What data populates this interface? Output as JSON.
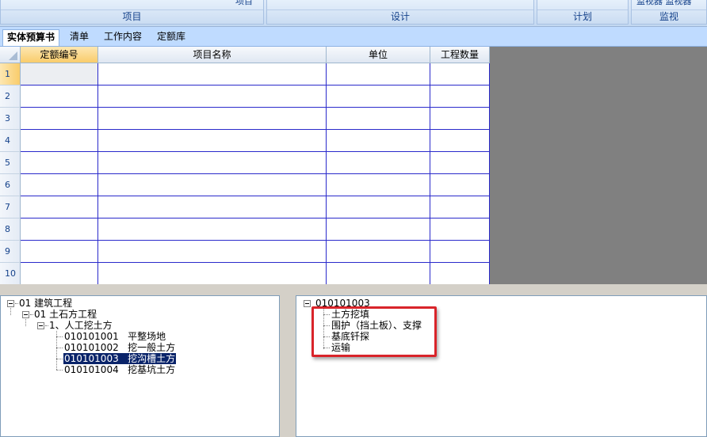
{
  "ribbon": {
    "groups": [
      {
        "label": "项目"
      },
      {
        "label": "设计"
      },
      {
        "label": "计划"
      },
      {
        "label": "监视",
        "cut_text": "监视器 监视器"
      }
    ],
    "cut_text_project": "项目"
  },
  "tabs": [
    {
      "label": "实体预算书",
      "active": true
    },
    {
      "label": "清单",
      "active": false
    },
    {
      "label": "工作内容",
      "active": false
    },
    {
      "label": "定额库",
      "active": false
    }
  ],
  "grid": {
    "columns": [
      "定额编号",
      "项目名称",
      "单位",
      "工程数量"
    ],
    "selected_column": "定额编号",
    "row_numbers": [
      "1",
      "2",
      "3",
      "4",
      "5",
      "6",
      "7",
      "8",
      "9",
      "10"
    ],
    "selected_row": "1"
  },
  "left_tree": {
    "n1": "01  建筑工程",
    "n2": "01  土石方工程",
    "n3": "1、人工挖土方",
    "items": [
      {
        "code": "010101001",
        "name": "平整场地"
      },
      {
        "code": "010101002",
        "name": "挖一般土方"
      },
      {
        "code": "010101003",
        "name": "挖沟槽土方",
        "selected": true
      },
      {
        "code": "010101004",
        "name": "挖基坑土方"
      }
    ]
  },
  "right_tree": {
    "root": "010101003",
    "items": [
      "土方挖填",
      "围护（挡土板）、支撑",
      "基底钎探",
      "运输"
    ]
  },
  "colors": {
    "highlight": "#0a246a",
    "annotation_box": "#d9242a",
    "grid_line": "#2a2acb"
  }
}
